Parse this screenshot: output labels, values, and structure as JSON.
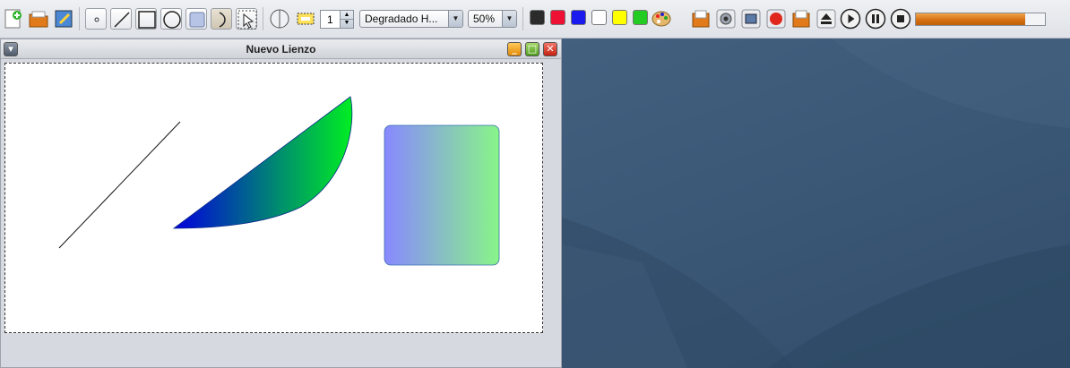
{
  "toolbar": {
    "stroke_width": "1",
    "fill_mode": "Degradado H...",
    "zoom": "50%",
    "playback_progress_percent": 85,
    "colors": [
      "#2b2b2b",
      "#ee1133",
      "#1a1aee",
      "#ffffff",
      "#ffff00",
      "#22cc22"
    ]
  },
  "window": {
    "title": "Nuevo Lienzo"
  },
  "canvas": {
    "gradient_shape_colors": [
      "#0000dd",
      "#00ee22"
    ],
    "rect_gradient_colors": [
      "#8888ff",
      "#88f588"
    ]
  }
}
